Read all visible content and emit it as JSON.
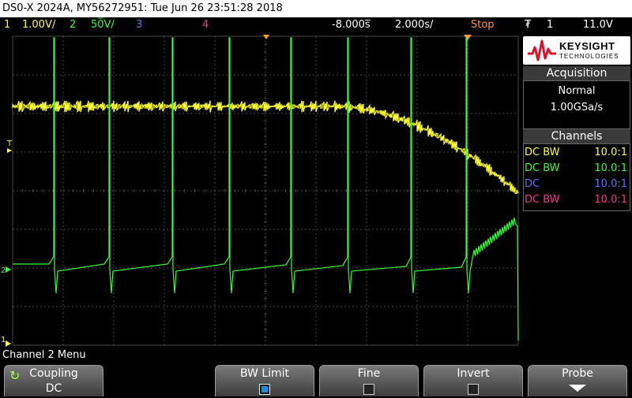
{
  "title_bar": "DS0-X 2024A, MY56272951: Tue Jun 26 23:51:28 2018",
  "status": {
    "ch1_num": "1",
    "ch1_scale": "1.00V/",
    "ch2_num": "2",
    "ch2_scale": "50̅V/",
    "ch3_num": "3",
    "ch4_num": "4",
    "time_offset": "-8.000s̅",
    "time_scale": "2.000s/",
    "run_state": "Stop",
    "trigger_icon": "trigger-edge-icon",
    "trigger_glyph": "₮",
    "trigger_source": "1",
    "trigger_level": "11.0V"
  },
  "colors": {
    "ch1": "#ffff33",
    "ch2": "#33ff33",
    "ch3": "#6b6bff",
    "ch4": "#ff3399",
    "grid": "#555555",
    "run_state": "#ff9933"
  },
  "branding": {
    "name": "KEYSIGHT",
    "sub": "TECHNOLOGIES"
  },
  "acquisition": {
    "header": "Acquisition",
    "mode": "Normal",
    "rate": "1.00GSa/s"
  },
  "channels": {
    "header": "Channels",
    "rows": [
      {
        "coupling": "DC BW",
        "probe": "10.0:1",
        "color": "#ffff33"
      },
      {
        "coupling": "DC BW",
        "probe": "10.0:1",
        "color": "#33ff33"
      },
      {
        "coupling": "DC",
        "probe": "10.0:1",
        "color": "#6b6bff"
      },
      {
        "coupling": "DC BW",
        "probe": "10.0:1",
        "color": "#ff3399"
      }
    ]
  },
  "screen_markers": {
    "ch1_ground": "1",
    "ch2_ground": "2",
    "trigger_marker": "T"
  },
  "menu_title": "Channel 2 Menu",
  "softkeys": [
    {
      "label": "Coupling",
      "value": "DC",
      "icon": "rotary-knob-icon"
    },
    {
      "label": "BW Limit",
      "state": true
    },
    {
      "label": "Fine",
      "state": false
    },
    {
      "label": "Invert",
      "state": false
    },
    {
      "label": "Probe",
      "icon": "chevron-down-icon"
    }
  ]
}
